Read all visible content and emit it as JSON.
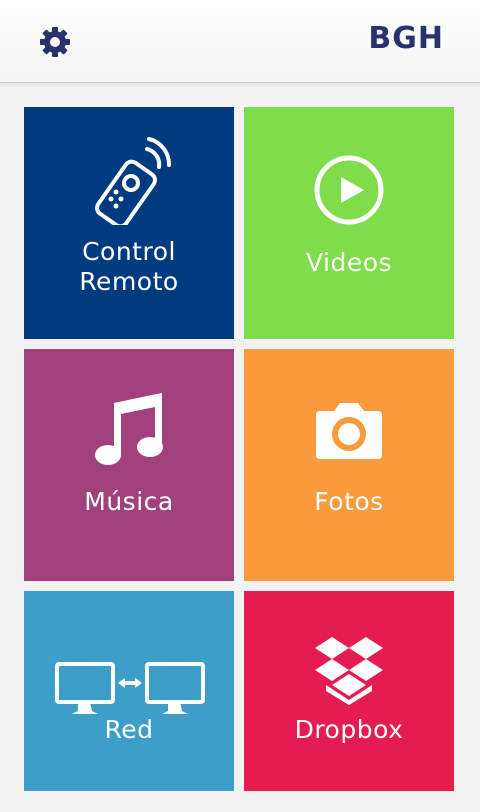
{
  "header": {
    "brand": "BGH",
    "settings_icon": "gear-icon"
  },
  "tiles": [
    {
      "label_line1": "Control",
      "label_line2": "Remoto",
      "icon": "remote-control-icon",
      "color": "#003b80"
    },
    {
      "label": "Videos",
      "icon": "play-circle-icon",
      "color": "#7fdc4b"
    },
    {
      "label": "Música",
      "icon": "music-note-icon",
      "color": "#a0417b"
    },
    {
      "label": "Fotos",
      "icon": "camera-icon",
      "color": "#f99a3c"
    },
    {
      "label": "Red",
      "icon": "network-monitors-icon",
      "color": "#3d9fc7"
    },
    {
      "label": "Dropbox",
      "icon": "dropbox-icon",
      "color": "#e41c50"
    }
  ]
}
